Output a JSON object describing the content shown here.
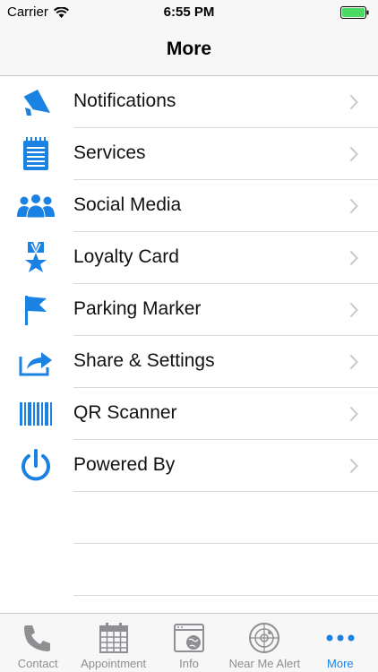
{
  "status_bar": {
    "carrier": "Carrier",
    "time": "6:55 PM"
  },
  "nav": {
    "title": "More"
  },
  "menu": [
    {
      "label": "Notifications",
      "icon": "megaphone-icon"
    },
    {
      "label": "Services",
      "icon": "notepad-icon"
    },
    {
      "label": "Social Media",
      "icon": "people-icon"
    },
    {
      "label": "Loyalty Card",
      "icon": "medal-icon"
    },
    {
      "label": "Parking Marker",
      "icon": "flag-icon"
    },
    {
      "label": "Share & Settings",
      "icon": "share-icon"
    },
    {
      "label": "QR Scanner",
      "icon": "barcode-icon"
    },
    {
      "label": "Powered By",
      "icon": "power-icon"
    }
  ],
  "tabs": [
    {
      "label": "Contact",
      "icon": "phone-icon"
    },
    {
      "label": "Appointment",
      "icon": "calendar-icon"
    },
    {
      "label": "Info",
      "icon": "globe-window-icon"
    },
    {
      "label": "Near Me Alert",
      "icon": "radar-icon"
    },
    {
      "label": "More",
      "icon": "more-dots-icon",
      "active": true
    }
  ],
  "colors": {
    "accent": "#1a82e2",
    "battery": "#4cd964",
    "inactive": "#8e8e93"
  }
}
